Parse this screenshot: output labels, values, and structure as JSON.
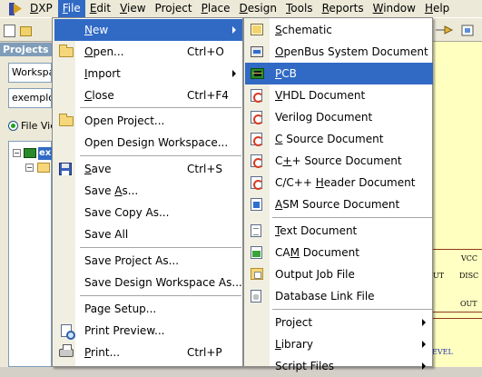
{
  "menubar": {
    "items": [
      "DXP",
      "File",
      "Edit",
      "View",
      "Project",
      "Place",
      "Design",
      "Tools",
      "Reports",
      "Window",
      "Help"
    ],
    "mnemonics": [
      "D",
      "F",
      "E",
      "V",
      "C",
      "P",
      "D",
      "T",
      "R",
      "W",
      "H"
    ],
    "active_item": "File"
  },
  "panel": {
    "title": "Projects",
    "workspace_field": "Workspace",
    "project_field": "exemplo",
    "view_radio_label": "File View",
    "tree_item": "ex"
  },
  "file_menu": {
    "items": [
      {
        "label": "New",
        "mn": "N",
        "shortcut": "",
        "submenu": true,
        "icon": "",
        "highlighted": true
      },
      {
        "label": "Open...",
        "mn": "O",
        "shortcut": "Ctrl+O",
        "icon": "open-folder-icon"
      },
      {
        "label": "Import",
        "mn": "I",
        "shortcut": "",
        "submenu": true,
        "icon": ""
      },
      {
        "label": "Close",
        "mn": "C",
        "shortcut": "Ctrl+F4",
        "icon": ""
      },
      {
        "label": "Open Project...",
        "mn": "J",
        "shortcut": "",
        "icon": "open-project-icon"
      },
      {
        "label": "Open Design Workspace...",
        "mn": "",
        "shortcut": "",
        "icon": ""
      },
      {
        "label": "Save",
        "mn": "S",
        "shortcut": "Ctrl+S",
        "icon": "save-icon"
      },
      {
        "label": "Save As...",
        "mn": "A",
        "shortcut": "",
        "icon": ""
      },
      {
        "label": "Save Copy As...",
        "mn": "Y",
        "shortcut": "",
        "icon": ""
      },
      {
        "label": "Save All",
        "mn": "L",
        "shortcut": "",
        "icon": ""
      },
      {
        "label": "Save Project As...",
        "mn": "",
        "shortcut": "",
        "icon": ""
      },
      {
        "label": "Save Design Workspace As...",
        "mn": "",
        "shortcut": "",
        "icon": ""
      },
      {
        "label": "Page Setup...",
        "mn": "U",
        "shortcut": "",
        "icon": ""
      },
      {
        "label": "Print Preview...",
        "mn": "V",
        "shortcut": "",
        "icon": "print-preview-icon"
      },
      {
        "label": "Print...",
        "mn": "P",
        "shortcut": "Ctrl+P",
        "icon": "printer-icon"
      }
    ]
  },
  "new_menu": {
    "items": [
      {
        "label": "Schematic",
        "mn": "S",
        "icon": "schematic-icon"
      },
      {
        "label": "OpenBus System Document",
        "mn": "O",
        "icon": "openbus-icon"
      },
      {
        "label": "PCB",
        "mn": "P",
        "icon": "pcb-icon",
        "highlighted": true
      },
      {
        "label": "VHDL Document",
        "mn": "V",
        "icon": "vhdl-icon"
      },
      {
        "label": "Verilog Document",
        "mn": "E",
        "icon": "verilog-icon"
      },
      {
        "label": "C Source Document",
        "mn": "C",
        "icon": "c-source-icon"
      },
      {
        "label": "C++ Source Document",
        "mn": "+",
        "icon": "cpp-source-icon"
      },
      {
        "label": "C/C++ Header Document",
        "mn": "H",
        "icon": "c-header-icon"
      },
      {
        "label": "ASM Source Document",
        "mn": "A",
        "icon": "asm-source-icon"
      },
      {
        "label": "Text Document",
        "mn": "T",
        "icon": "text-document-icon"
      },
      {
        "label": "CAM Document",
        "mn": "M",
        "icon": "cam-document-icon"
      },
      {
        "label": "Output Job File",
        "mn": "U",
        "icon": "output-job-icon"
      },
      {
        "label": "Database Link File",
        "mn": "K",
        "icon": "database-link-icon"
      },
      {
        "label": "Project",
        "mn": "",
        "submenu": true
      },
      {
        "label": "Library",
        "mn": "L",
        "submenu": true
      },
      {
        "label": "Script Files",
        "mn": "",
        "submenu": true
      }
    ]
  },
  "canvas": {
    "pins": [
      "VCC",
      "DISC",
      "OUT",
      "UT"
    ],
    "label": "EVEL"
  },
  "colors": {
    "menubar_bg": "#ece9d8",
    "highlight": "#316ac5",
    "canvas_bg": "#ffffc0"
  }
}
